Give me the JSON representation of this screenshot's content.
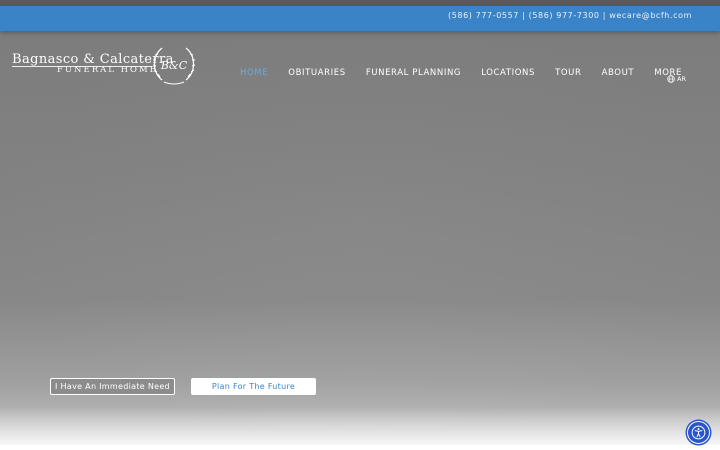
{
  "header": {
    "contact": {
      "phone_1": "(586) 777-0557",
      "phone_2": "(586) 977-7300",
      "email": "wecare@bcfh.com",
      "separator": "|"
    },
    "logo": {
      "line_1": "Bagnasco & Calcaterra",
      "line_2": "FUNERAL HOME",
      "monogram": "B&C"
    },
    "nav": [
      {
        "label": "HOME",
        "active": true
      },
      {
        "label": "OBITUARIES",
        "active": false
      },
      {
        "label": "FUNERAL PLANNING",
        "active": false
      },
      {
        "label": "LOCATIONS",
        "active": false
      },
      {
        "label": "TOUR",
        "active": false
      },
      {
        "label": "ABOUT",
        "active": false
      },
      {
        "label": "MORE",
        "active": false
      }
    ],
    "language": {
      "label": "AR",
      "icon": "globe-icon"
    }
  },
  "hero": {
    "buttons": {
      "immediate_need": "I Have An Immediate Need",
      "plan_future": "Plan For The Future"
    }
  },
  "accessibility": {
    "icon": "accessibility-icon"
  },
  "colors": {
    "brand_blue": "#3a83c7",
    "nav_active": "#6aa9e0",
    "accessibility_blue": "#2a55c9"
  }
}
